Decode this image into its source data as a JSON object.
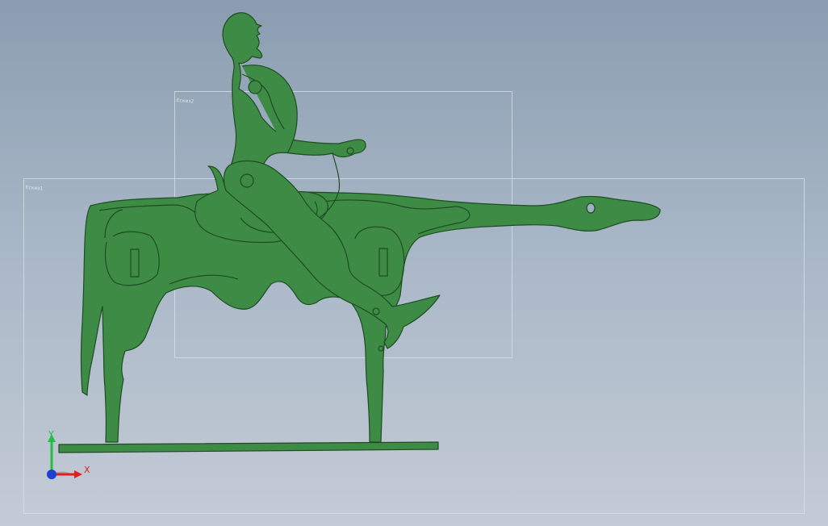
{
  "viewport": {
    "background_top": "#8a9db0",
    "background_bottom": "#c4cbd6"
  },
  "model": {
    "part_color": "#3d8b45",
    "edge_color": "#1e4d22"
  },
  "sketches": [
    {
      "label": "Ескиз2"
    },
    {
      "label": "Ескиз1"
    }
  ],
  "triad": {
    "x_label": "X",
    "y_label": "Y",
    "x_color": "#e02020",
    "y_color": "#20c040",
    "z_color": "#2040d0"
  }
}
